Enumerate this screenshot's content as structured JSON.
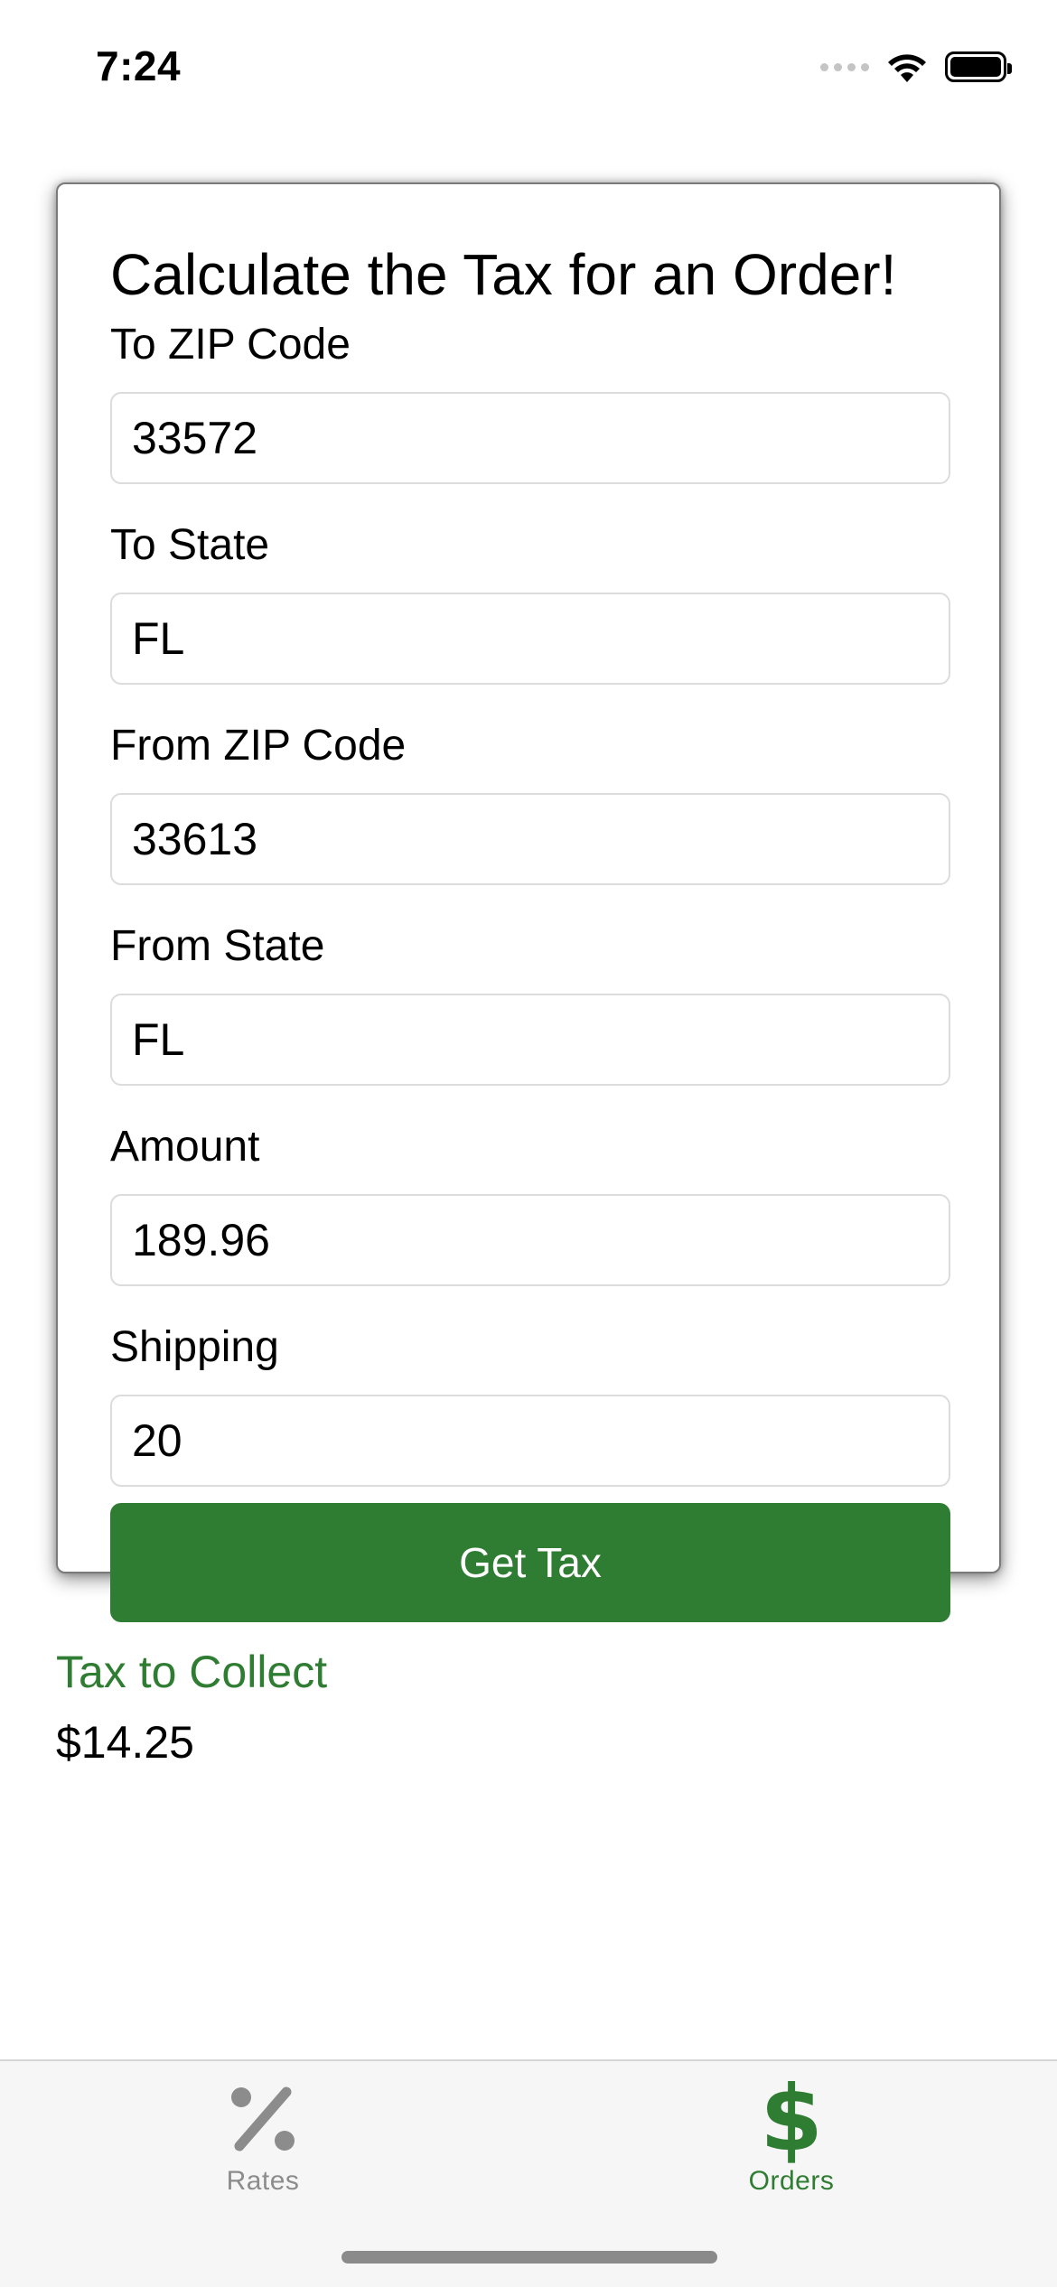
{
  "status_bar": {
    "time": "7:24",
    "signal_icon": "signal-dots-icon",
    "wifi_icon": "wifi-icon",
    "battery_icon": "battery-icon"
  },
  "form": {
    "title": "Calculate the Tax for an Order!",
    "fields": [
      {
        "label": "To ZIP Code",
        "value": "33572"
      },
      {
        "label": "To State",
        "value": "FL"
      },
      {
        "label": "From ZIP Code",
        "value": "33613"
      },
      {
        "label": "From State",
        "value": "FL"
      },
      {
        "label": "Amount",
        "value": "189.96"
      },
      {
        "label": "Shipping",
        "value": "20"
      }
    ],
    "button_label": "Get Tax"
  },
  "result": {
    "label": "Tax to Collect",
    "value": "$14.25"
  },
  "tab_bar": {
    "tabs": [
      {
        "label": "Rates",
        "icon": "percent-icon",
        "active": false
      },
      {
        "label": "Orders",
        "icon": "dollar-icon",
        "active": true
      }
    ]
  },
  "colors": {
    "accent": "#2f7d32",
    "inactive": "#8c8c8c"
  }
}
